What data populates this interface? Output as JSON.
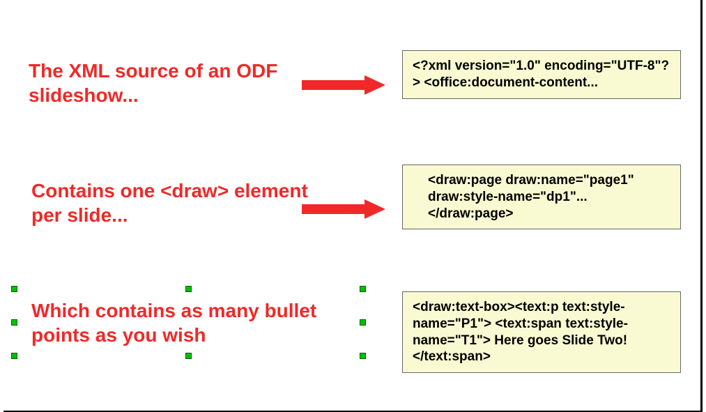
{
  "rows": [
    {
      "label": "The XML source of an ODF slideshow...",
      "code": "<?xml version=\"1.0\" encoding=\"UTF-8\"?> <office:document-content..."
    },
    {
      "label": "Contains one <draw> element per slide...",
      "code": "<draw:page draw:name=\"page1\" draw:style-name=\"dp1\"...</draw:page>"
    },
    {
      "label": "Which contains as many bullet points as you wish",
      "code": "<draw:text-box><text:p text:style-name=\"P1\"> <text:span text:style-name=\"T1\"> Here goes Slide Two!</text:span>"
    }
  ]
}
